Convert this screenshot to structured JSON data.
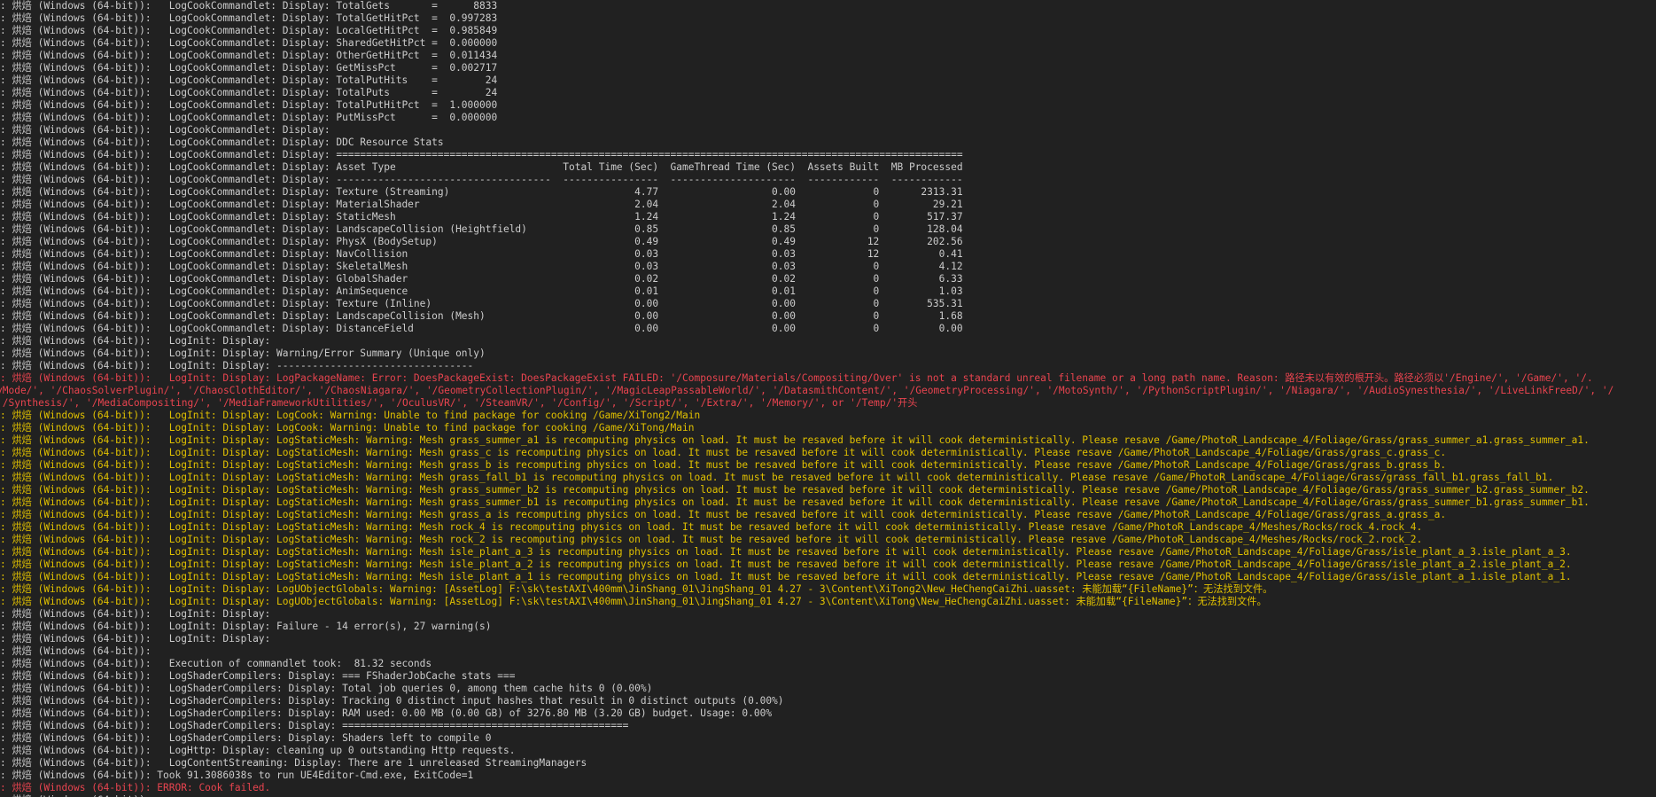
{
  "colors": {
    "background": "#212121",
    "text": "#cccccc",
    "warning": "#e0c000",
    "error": "#e8444f"
  },
  "prefix": ": 烘焙 (Windows (64-bit)):",
  "ddc_stats": [
    {
      "name": "TotalGets",
      "value": "8833"
    },
    {
      "name": "TotalGetHitPct",
      "value": "0.997283"
    },
    {
      "name": "LocalGetHitPct",
      "value": "0.985849"
    },
    {
      "name": "SharedGetHitPct",
      "value": "0.000000"
    },
    {
      "name": "OtherGetHitPct",
      "value": "0.011434"
    },
    {
      "name": "GetMissPct",
      "value": "0.002717"
    },
    {
      "name": "TotalPutHits",
      "value": "24"
    },
    {
      "name": "TotalPuts",
      "value": "24"
    },
    {
      "name": "TotalPutHitPct",
      "value": "1.000000"
    },
    {
      "name": "PutMissPct",
      "value": "0.000000"
    }
  ],
  "cook_category": "LogCookCommandlet: Display:",
  "resource_stats_title": "DDC Resource Stats",
  "resource_table": {
    "columns": [
      "Asset Type",
      "Total Time (Sec)",
      "GameThread Time (Sec)",
      "Assets Built",
      "MB Processed"
    ],
    "rows": [
      [
        "Texture (Streaming)",
        "4.77",
        "0.00",
        "0",
        "2313.31"
      ],
      [
        "MaterialShader",
        "2.04",
        "2.04",
        "0",
        "29.21"
      ],
      [
        "StaticMesh",
        "1.24",
        "1.24",
        "0",
        "517.37"
      ],
      [
        "LandscapeCollision (Heightfield)",
        "0.85",
        "0.85",
        "0",
        "128.04"
      ],
      [
        "PhysX (BodySetup)",
        "0.49",
        "0.49",
        "12",
        "202.56"
      ],
      [
        "NavCollision",
        "0.03",
        "0.03",
        "12",
        "0.41"
      ],
      [
        "SkeletalMesh",
        "0.03",
        "0.03",
        "0",
        "4.12"
      ],
      [
        "GlobalShader",
        "0.02",
        "0.02",
        "0",
        "6.33"
      ],
      [
        "AnimSequence",
        "0.01",
        "0.01",
        "0",
        "1.03"
      ],
      [
        "Texture (Inline)",
        "0.00",
        "0.00",
        "0",
        "535.31"
      ],
      [
        "LandscapeCollision (Mesh)",
        "0.00",
        "0.00",
        "0",
        "1.68"
      ],
      [
        "DistanceField",
        "0.00",
        "0.00",
        "0",
        "0.00"
      ]
    ]
  },
  "log_lines": [
    {
      "level": "info",
      "msg": "   LogInit: Display:"
    },
    {
      "level": "info",
      "msg": "   LogInit: Display: Warning/Error Summary (Unique only)"
    },
    {
      "level": "info",
      "msg": "   LogInit: Display: ---------------------------------"
    },
    {
      "level": "error",
      "msg": "   LogInit: Display: LogPackageName: Error: DoesPackageExist: DoesPackageExist FAILED: '/Composure/Materials/Compositing/Over' is not a standard unreal filename or a long path name. Reason: 路径未以有效的根开头。路径必须以'/Engine/', '/Game/', '/."
    },
    {
      "level": "error",
      "cont": true,
      "raw": true,
      "msg": "yMode/', '/ChaosSolverPlugin/', '/ChaosClothEditor/', '/ChaosNiagara/', '/GeometryCollectionPlugin/', '/MagicLeapPassableWorld/', '/DatasmithContent/', '/GeometryProcessing/', '/MotoSynth/', '/PythonScriptPlugin/', '/Niagara/', '/AudioSynesthesia/', '/LiveLinkFreeD/', '/"
    },
    {
      "level": "error",
      "cont": true,
      "raw": true,
      "msg": "'/Synthesis/', '/MediaCompositing/', '/MediaFrameworkUtilities/', '/OculusVR/', '/SteamVR/', '/Config/', '/Script/', '/Extra/', '/Memory/', or '/Temp/'开头"
    },
    {
      "level": "warning",
      "msg": "   LogInit: Display: LogCook: Warning: Unable to find package for cooking /Game/XiTong2/Main"
    },
    {
      "level": "warning",
      "msg": "   LogInit: Display: LogCook: Warning: Unable to find package for cooking /Game/XiTong/Main"
    },
    {
      "level": "warning",
      "msg": "   LogInit: Display: LogStaticMesh: Warning: Mesh grass_summer_a1 is recomputing physics on load. It must be resaved before it will cook deterministically. Please resave /Game/PhotoR_Landscape_4/Foliage/Grass/grass_summer_a1.grass_summer_a1."
    },
    {
      "level": "warning",
      "msg": "   LogInit: Display: LogStaticMesh: Warning: Mesh grass_c is recomputing physics on load. It must be resaved before it will cook deterministically. Please resave /Game/PhotoR_Landscape_4/Foliage/Grass/grass_c.grass_c."
    },
    {
      "level": "warning",
      "msg": "   LogInit: Display: LogStaticMesh: Warning: Mesh grass_b is recomputing physics on load. It must be resaved before it will cook deterministically. Please resave /Game/PhotoR_Landscape_4/Foliage/Grass/grass_b.grass_b."
    },
    {
      "level": "warning",
      "msg": "   LogInit: Display: LogStaticMesh: Warning: Mesh grass_fall_b1 is recomputing physics on load. It must be resaved before it will cook deterministically. Please resave /Game/PhotoR_Landscape_4/Foliage/Grass/grass_fall_b1.grass_fall_b1."
    },
    {
      "level": "warning",
      "msg": "   LogInit: Display: LogStaticMesh: Warning: Mesh grass_summer_b2 is recomputing physics on load. It must be resaved before it will cook deterministically. Please resave /Game/PhotoR_Landscape_4/Foliage/Grass/grass_summer_b2.grass_summer_b2."
    },
    {
      "level": "warning",
      "msg": "   LogInit: Display: LogStaticMesh: Warning: Mesh grass_summer_b1 is recomputing physics on load. It must be resaved before it will cook deterministically. Please resave /Game/PhotoR_Landscape_4/Foliage/Grass/grass_summer_b1.grass_summer_b1."
    },
    {
      "level": "warning",
      "msg": "   LogInit: Display: LogStaticMesh: Warning: Mesh grass_a is recomputing physics on load. It must be resaved before it will cook deterministically. Please resave /Game/PhotoR_Landscape_4/Foliage/Grass/grass_a.grass_a."
    },
    {
      "level": "warning",
      "msg": "   LogInit: Display: LogStaticMesh: Warning: Mesh rock_4 is recomputing physics on load. It must be resaved before it will cook deterministically. Please resave /Game/PhotoR_Landscape_4/Meshes/Rocks/rock_4.rock_4."
    },
    {
      "level": "warning",
      "msg": "   LogInit: Display: LogStaticMesh: Warning: Mesh rock_2 is recomputing physics on load. It must be resaved before it will cook deterministically. Please resave /Game/PhotoR_Landscape_4/Meshes/Rocks/rock_2.rock_2."
    },
    {
      "level": "warning",
      "msg": "   LogInit: Display: LogStaticMesh: Warning: Mesh isle_plant_a_3 is recomputing physics on load. It must be resaved before it will cook deterministically. Please resave /Game/PhotoR_Landscape_4/Foliage/Grass/isle_plant_a_3.isle_plant_a_3."
    },
    {
      "level": "warning",
      "msg": "   LogInit: Display: LogStaticMesh: Warning: Mesh isle_plant_a_2 is recomputing physics on load. It must be resaved before it will cook deterministically. Please resave /Game/PhotoR_Landscape_4/Foliage/Grass/isle_plant_a_2.isle_plant_a_2."
    },
    {
      "level": "warning",
      "msg": "   LogInit: Display: LogStaticMesh: Warning: Mesh isle_plant_a_1 is recomputing physics on load. It must be resaved before it will cook deterministically. Please resave /Game/PhotoR_Landscape_4/Foliage/Grass/isle_plant_a_1.isle_plant_a_1."
    },
    {
      "level": "warning",
      "msg": "   LogInit: Display: LogUObjectGlobals: Warning: [AssetLog] F:\\sk\\testAXI\\400mm\\JinShang_01\\JingShang_01 4.27 - 3\\Content\\XiTong2\\New_HeChengCaiZhi.uasset: 未能加载“{FileName}”：无法找到文件。"
    },
    {
      "level": "warning",
      "msg": "   LogInit: Display: LogUObjectGlobals: Warning: [AssetLog] F:\\sk\\testAXI\\400mm\\JinShang_01\\JingShang_01 4.27 - 3\\Content\\XiTong\\New_HeChengCaiZhi.uasset: 未能加载“{FileName}”：无法找到文件。"
    },
    {
      "level": "info",
      "msg": "   LogInit: Display:"
    },
    {
      "level": "info",
      "msg": "   LogInit: Display: Failure - 14 error(s), 27 warning(s)"
    },
    {
      "level": "info",
      "msg": "   LogInit: Display:"
    },
    {
      "level": "info",
      "msg": ""
    },
    {
      "level": "info",
      "msg": "   Execution of commandlet took:  81.32 seconds"
    },
    {
      "level": "info",
      "msg": "   LogShaderCompilers: Display: === FShaderJobCache stats ==="
    },
    {
      "level": "info",
      "msg": "   LogShaderCompilers: Display: Total job queries 0, among them cache hits 0 (0.00%)"
    },
    {
      "level": "info",
      "msg": "   LogShaderCompilers: Display: Tracking 0 distinct input hashes that result in 0 distinct outputs (0.00%)"
    },
    {
      "level": "info",
      "msg": "   LogShaderCompilers: Display: RAM used: 0.00 MB (0.00 GB) of 3276.80 MB (3.20 GB) budget. Usage: 0.00%"
    },
    {
      "level": "info",
      "msg": "   LogShaderCompilers: Display: ================================================"
    },
    {
      "level": "info",
      "msg": "   LogShaderCompilers: Display: Shaders left to compile 0"
    },
    {
      "level": "info",
      "msg": "   LogHttp: Display: cleaning up 0 outstanding Http requests."
    },
    {
      "level": "info",
      "msg": "   LogContentStreaming: Display: There are 1 unreleased StreamingManagers"
    },
    {
      "level": "info",
      "msg": " Took 91.3086038s to run UE4Editor-Cmd.exe, ExitCode=1"
    },
    {
      "level": "error",
      "msg": " ERROR: Cook failed."
    },
    {
      "level": "info",
      "msg": ""
    }
  ]
}
